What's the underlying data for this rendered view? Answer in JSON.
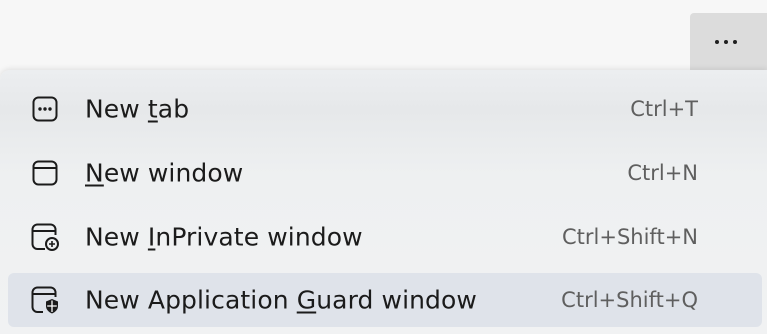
{
  "toolbar": {
    "more_button_icon": "ellipsis-icon"
  },
  "menu": {
    "items": [
      {
        "label_before": "New ",
        "label_accel": "t",
        "label_after": "ab",
        "shortcut": "Ctrl+T",
        "icon": "new-tab-icon"
      },
      {
        "label_before": "",
        "label_accel": "N",
        "label_after": "ew window",
        "shortcut": "Ctrl+N",
        "icon": "new-window-icon"
      },
      {
        "label_before": "New ",
        "label_accel": "I",
        "label_after": "nPrivate window",
        "shortcut": "Ctrl+Shift+N",
        "icon": "inprivate-window-icon"
      },
      {
        "label_before": "New Application ",
        "label_accel": "G",
        "label_after": "uard window",
        "shortcut": "Ctrl+Shift+Q",
        "icon": "application-guard-icon"
      }
    ]
  },
  "colors": {
    "highlight": "#dfe3ea",
    "text": "#1b1b1b",
    "shortcut_text": "#5f5f5f",
    "more_button_bg": "#dcdcdc"
  }
}
